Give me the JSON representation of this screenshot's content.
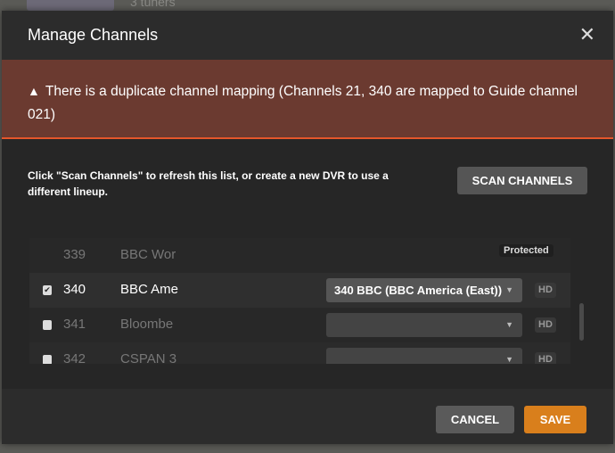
{
  "background": {
    "tuners_text": "3 tuners"
  },
  "dialog": {
    "title": "Manage Channels",
    "alert": {
      "icon": "warning-icon",
      "message": "There is a duplicate channel mapping (Channels 21, 340 are mapped to Guide channel 021)"
    },
    "info": "Click \"Scan Channels\" to refresh this list, or create a new DVR to use a different lineup.",
    "scan_label": "SCAN CHANNELS",
    "channels": [
      {
        "number": "339",
        "name": "BBC Wor",
        "badge": "Protected",
        "checked": null
      },
      {
        "number": "340",
        "name": "BBC Ame",
        "mapping": "340 BBC (BBC America (East))",
        "hd": "HD",
        "checked": true
      },
      {
        "number": "341",
        "name": "Bloombe",
        "mapping": "",
        "hd": "HD",
        "checked": false
      },
      {
        "number": "342",
        "name": "CSPAN 3",
        "mapping": "",
        "hd": "HD",
        "checked": false
      }
    ],
    "cancel_label": "CANCEL",
    "save_label": "SAVE"
  },
  "colors": {
    "accent": "#d97f1c",
    "alert_bg": "#6b3a30",
    "alert_border": "#e5562b"
  }
}
